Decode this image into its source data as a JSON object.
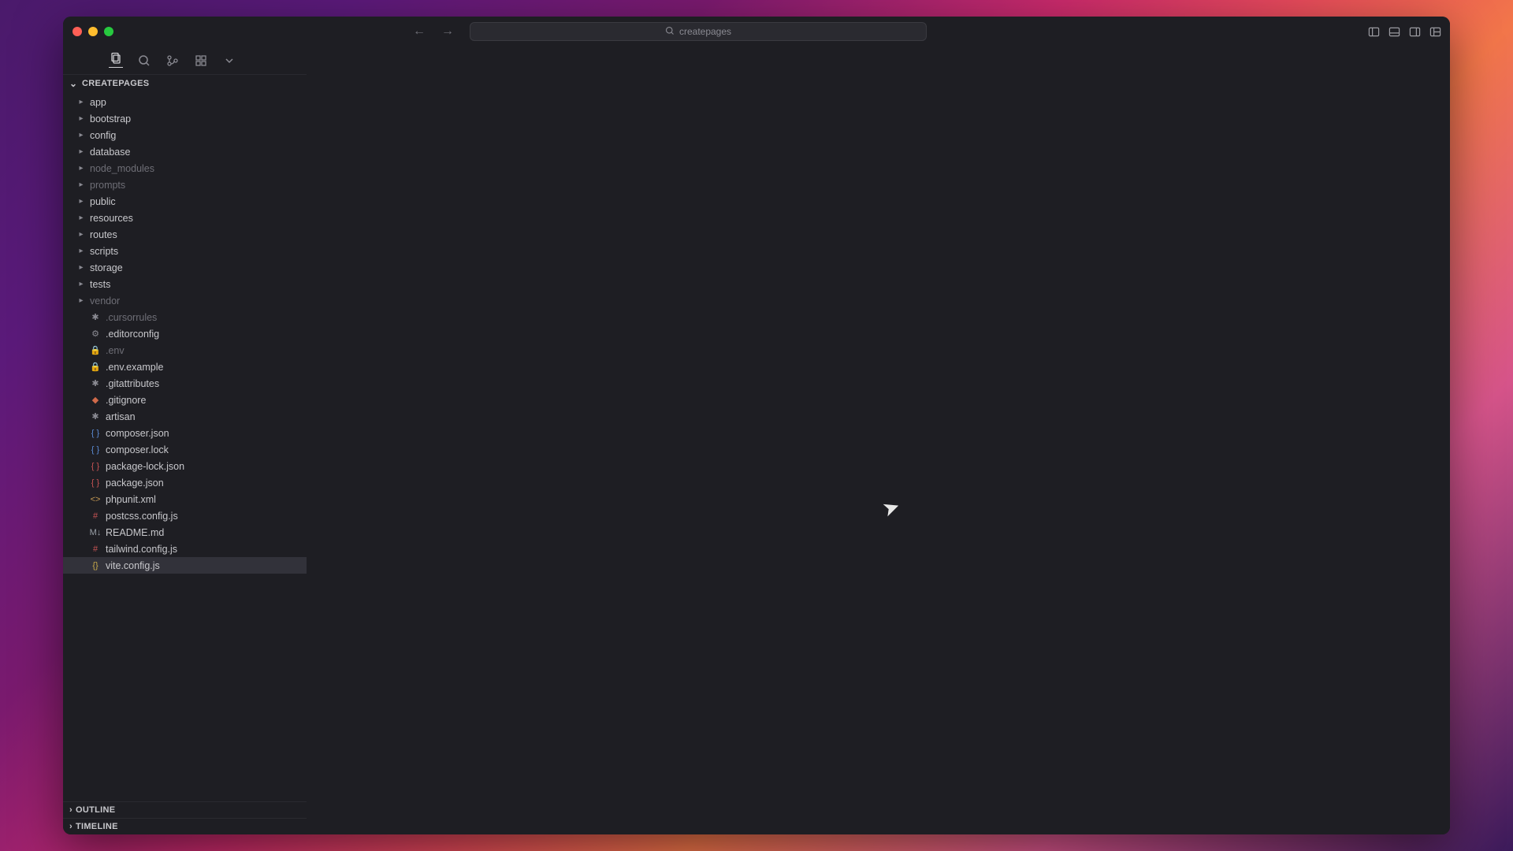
{
  "titlebar": {
    "search_label": "createpages"
  },
  "sidebar": {
    "project_name": "CREATEPAGES",
    "outline_label": "OUTLINE",
    "timeline_label": "TIMELINE",
    "tree": [
      {
        "name": "app",
        "type": "folder",
        "dim": false
      },
      {
        "name": "bootstrap",
        "type": "folder",
        "dim": false
      },
      {
        "name": "config",
        "type": "folder",
        "dim": false
      },
      {
        "name": "database",
        "type": "folder",
        "dim": false
      },
      {
        "name": "node_modules",
        "type": "folder",
        "dim": true
      },
      {
        "name": "prompts",
        "type": "folder",
        "dim": true
      },
      {
        "name": "public",
        "type": "folder",
        "dim": false
      },
      {
        "name": "resources",
        "type": "folder",
        "dim": false
      },
      {
        "name": "routes",
        "type": "folder",
        "dim": false
      },
      {
        "name": "scripts",
        "type": "folder",
        "dim": false
      },
      {
        "name": "storage",
        "type": "folder",
        "dim": false
      },
      {
        "name": "tests",
        "type": "folder",
        "dim": false
      },
      {
        "name": "vendor",
        "type": "folder",
        "dim": true
      },
      {
        "name": ".cursorrules",
        "type": "file",
        "icon": "aster",
        "dim": true
      },
      {
        "name": ".editorconfig",
        "type": "file",
        "icon": "gear",
        "dim": false
      },
      {
        "name": ".env",
        "type": "file",
        "icon": "lock",
        "dim": true
      },
      {
        "name": ".env.example",
        "type": "file",
        "icon": "lock",
        "dim": false
      },
      {
        "name": ".gitattributes",
        "type": "file",
        "icon": "aster",
        "dim": false
      },
      {
        "name": ".gitignore",
        "type": "file",
        "icon": "gitig",
        "dim": false
      },
      {
        "name": "artisan",
        "type": "file",
        "icon": "aster",
        "dim": false
      },
      {
        "name": "composer.json",
        "type": "file",
        "icon": "json-blue",
        "dim": false
      },
      {
        "name": "composer.lock",
        "type": "file",
        "icon": "json-blue",
        "dim": false
      },
      {
        "name": "package-lock.json",
        "type": "file",
        "icon": "json-red",
        "dim": false
      },
      {
        "name": "package.json",
        "type": "file",
        "icon": "json-red",
        "dim": false
      },
      {
        "name": "phpunit.xml",
        "type": "file",
        "icon": "xml",
        "dim": false
      },
      {
        "name": "postcss.config.js",
        "type": "file",
        "icon": "js",
        "dim": false
      },
      {
        "name": "README.md",
        "type": "file",
        "icon": "md",
        "dim": false
      },
      {
        "name": "tailwind.config.js",
        "type": "file",
        "icon": "js",
        "dim": false
      },
      {
        "name": "vite.config.js",
        "type": "file",
        "icon": "vite",
        "dim": false,
        "selected": true
      }
    ]
  }
}
